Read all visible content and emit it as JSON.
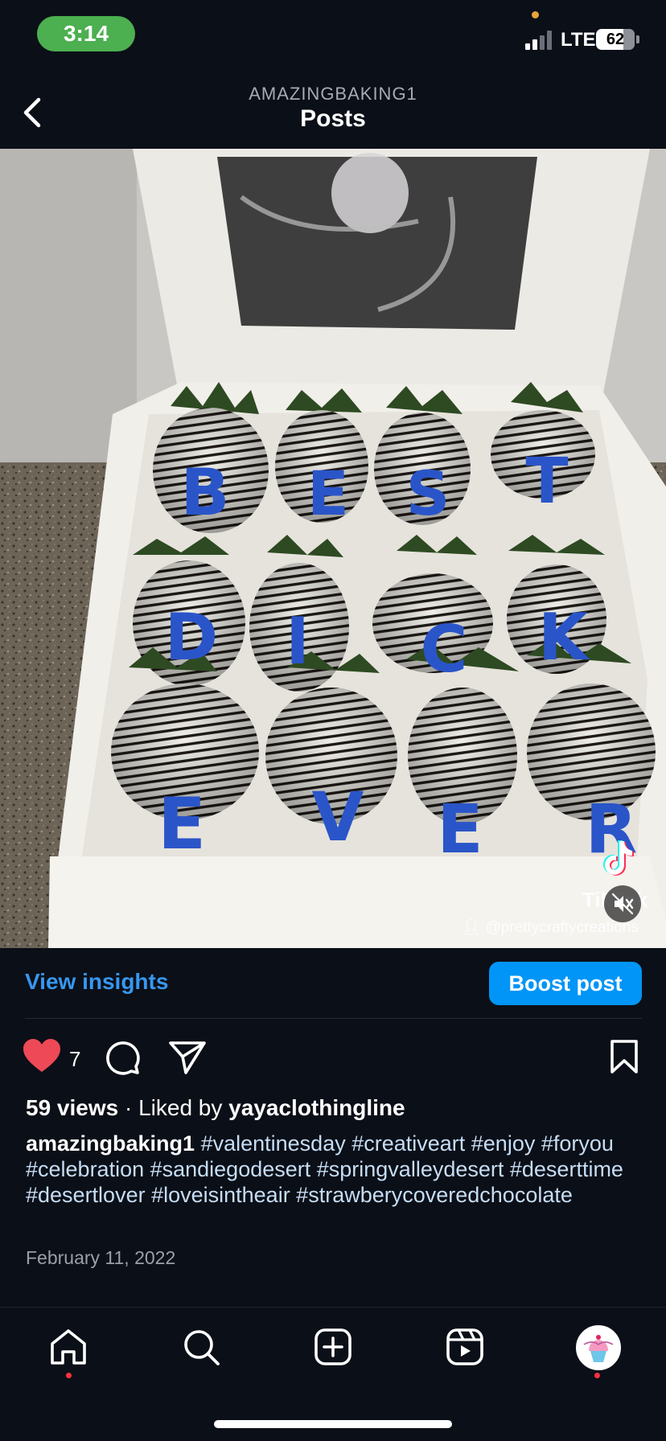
{
  "status_bar": {
    "time": "3:14",
    "network": "LTE",
    "battery": "62"
  },
  "header": {
    "account": "AMAZINGBAKING1",
    "title": "Posts"
  },
  "post": {
    "box_letters": [
      "B",
      "E",
      "S",
      "T",
      "D",
      "I",
      "C",
      "K",
      "E",
      "V",
      "E",
      "R"
    ],
    "tiktok_watermark": "TikTok",
    "tiktok_credit": "@prettycraftycreations",
    "insights_label": "View insights",
    "boost_label": "Boost post",
    "like_count": "7",
    "views": "59 views",
    "liked_by_prefix": "Liked by",
    "liked_by_user": "yayaclothingline",
    "caption_user": "amazingbaking1",
    "caption_tags": "#valentinesday #creativeart #enjoy #foryou #celebration #sandiegodesert #springvalleydesert #deserttime #desertlover #loveisintheair #strawberycoveredchocolate",
    "date": "February 11, 2022"
  },
  "icons": {
    "back": "chevron-left-icon",
    "like": "heart-icon",
    "comment": "comment-icon",
    "share": "paper-plane-icon",
    "save": "bookmark-icon",
    "mute": "speaker-muted-icon",
    "nav": [
      "home-icon",
      "search-icon",
      "create-icon",
      "reels-icon",
      "profile-avatar"
    ]
  },
  "colors": {
    "background": "#0b0f17",
    "link_blue": "#3797f0",
    "button_blue": "#0095f6",
    "like_red": "#ed4956",
    "status_green": "#4caf50"
  }
}
